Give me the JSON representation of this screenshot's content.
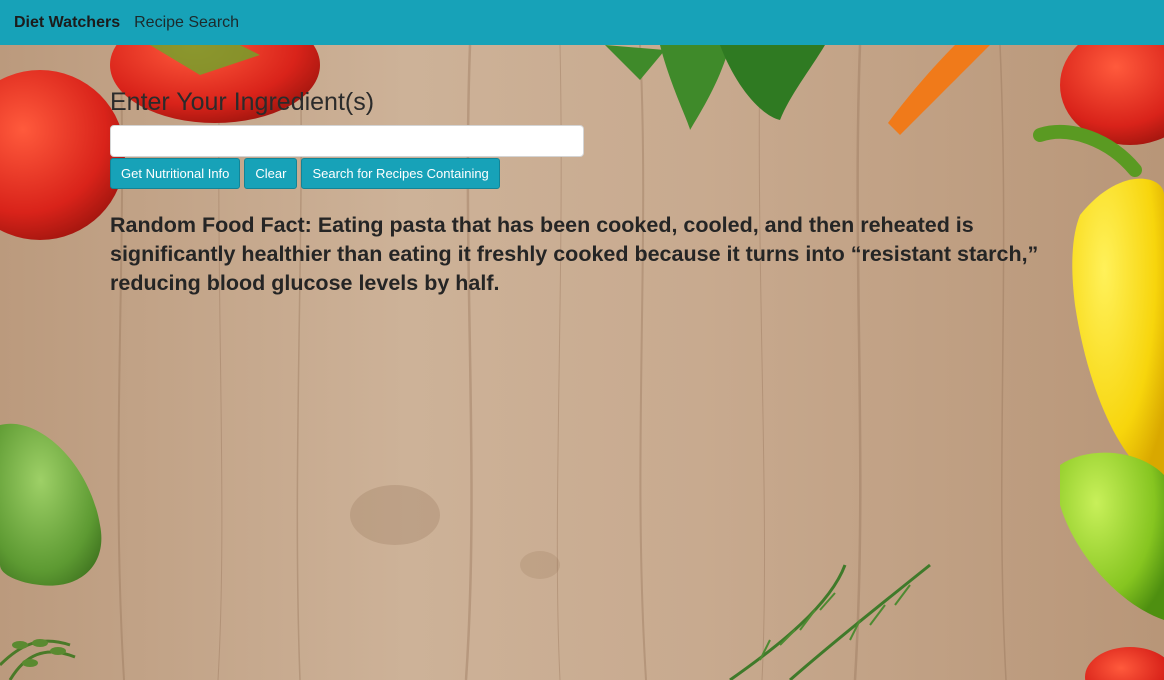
{
  "navbar": {
    "brand": "Diet Watchers",
    "link": "Recipe Search",
    "color": "#17a2b8"
  },
  "main": {
    "heading": "Enter Your Ingredient(s)",
    "input_value": "",
    "input_placeholder": "",
    "buttons": {
      "nutrition": "Get Nutritional Info",
      "clear": "Clear",
      "search": "Search for Recipes Containing"
    },
    "fact_label": "Random Food Fact:",
    "fact_text": "Eating pasta that has been cooked, cooled, and then reheated is significantly healthier than eating it freshly cooked because it turns into “resistant starch,” reducing blood glucose levels by half."
  }
}
